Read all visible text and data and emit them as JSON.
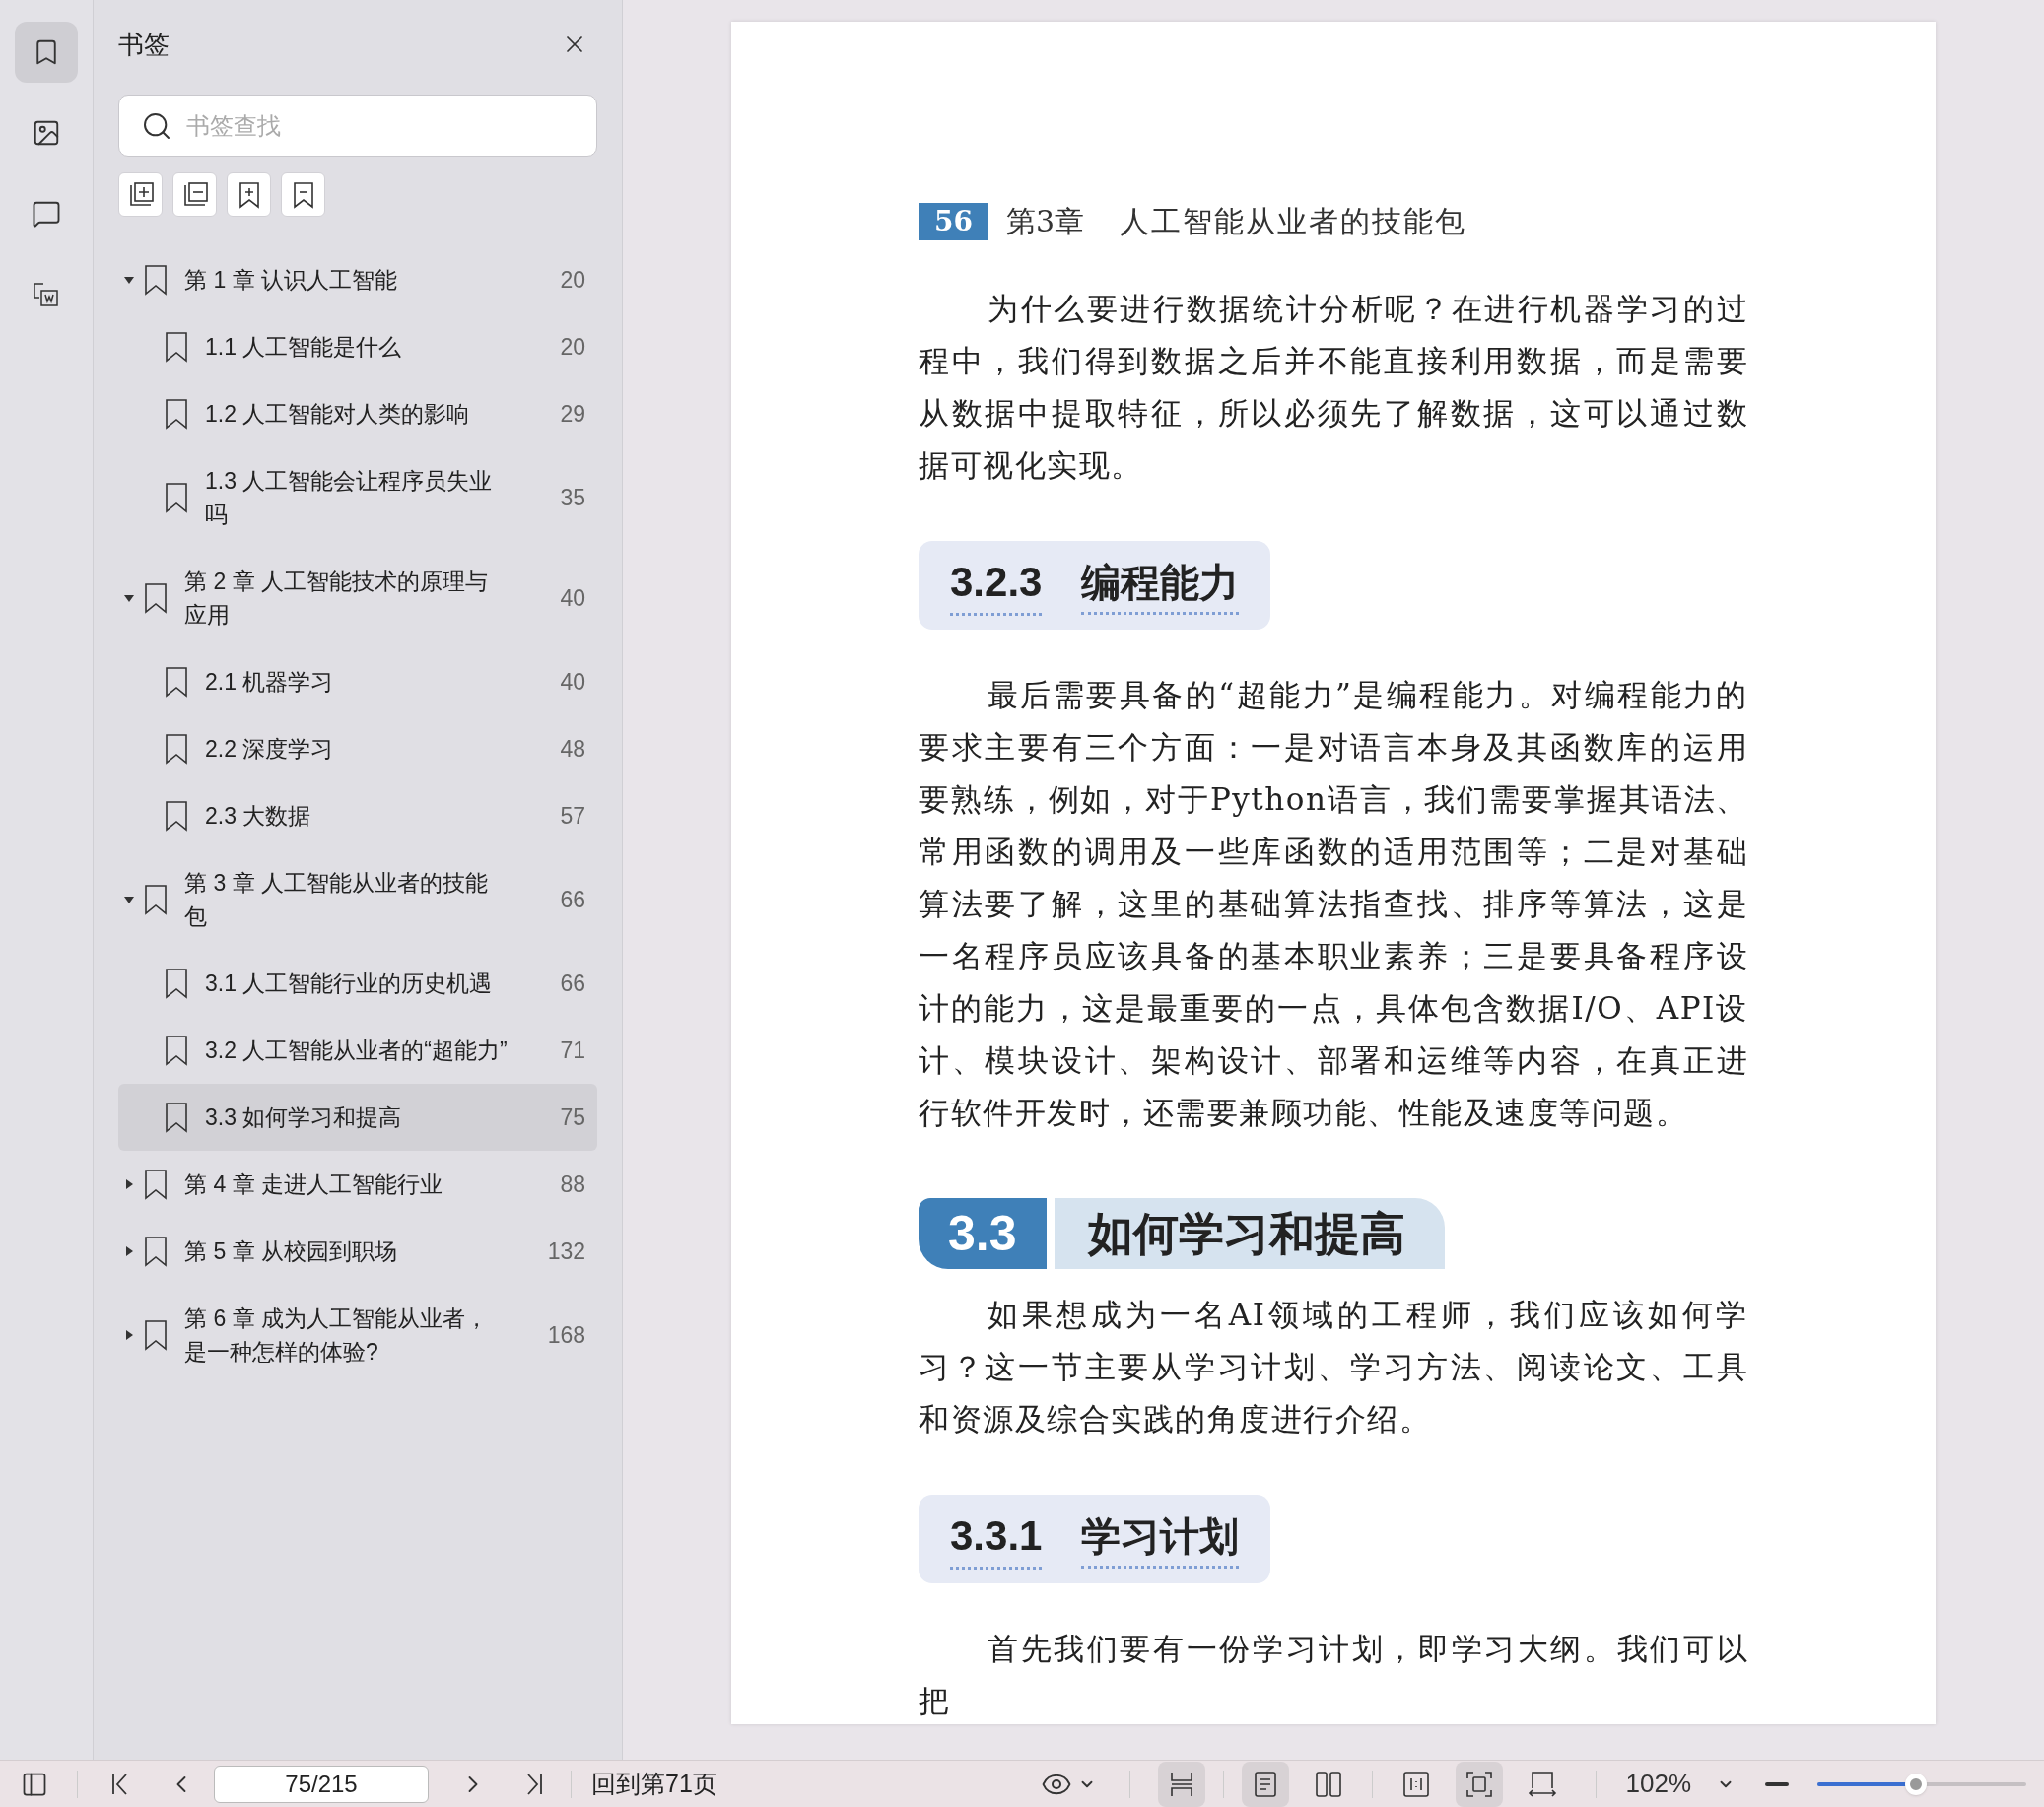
{
  "rail": [
    {
      "kind": "bookmarks",
      "selected": true
    },
    {
      "kind": "images",
      "selected": false
    },
    {
      "kind": "comments",
      "selected": false
    },
    {
      "kind": "convert",
      "selected": false
    }
  ],
  "sidebar": {
    "title": "书签",
    "search": {
      "placeholder": "书签查找"
    },
    "tools": [
      {
        "kind": "expand"
      },
      {
        "kind": "collapse"
      },
      {
        "kind": "add"
      },
      {
        "kind": "remove"
      }
    ],
    "items": [
      {
        "label": "第 1 章 认识人工智能",
        "page": "20",
        "expanded": true,
        "selected": false,
        "children": [
          {
            "label": "1.1 人工智能是什么",
            "page": "20",
            "selected": false
          },
          {
            "label": "1.2 人工智能对人类的影响",
            "page": "29",
            "selected": false
          },
          {
            "label": "1.3 人工智能会让程序员失业吗",
            "page": "35",
            "selected": false
          }
        ]
      },
      {
        "label": "第 2 章 人工智能技术的原理与应用",
        "page": "40",
        "expanded": true,
        "selected": false,
        "children": [
          {
            "label": "2.1 机器学习",
            "page": "40",
            "selected": false
          },
          {
            "label": "2.2 深度学习",
            "page": "48",
            "selected": false
          },
          {
            "label": "2.3 大数据",
            "page": "57",
            "selected": false
          }
        ]
      },
      {
        "label": "第 3 章 人工智能从业者的技能包",
        "page": "66",
        "expanded": true,
        "selected": false,
        "children": [
          {
            "label": "3.1 人工智能行业的历史机遇",
            "page": "66",
            "selected": false
          },
          {
            "label": "3.2 人工智能从业者的“超能力”",
            "page": "71",
            "selected": false
          },
          {
            "label": "3.3 如何学习和提高",
            "page": "75",
            "selected": true
          }
        ]
      },
      {
        "label": "第 4 章 走进人工智能行业",
        "page": "88",
        "expanded": false,
        "selected": false
      },
      {
        "label": "第 5 章 从校园到职场",
        "page": "132",
        "expanded": false,
        "selected": false
      },
      {
        "label": "第 6 章 成为人工智能从业者，是一种怎样的体验?",
        "page": "168",
        "expanded": false,
        "selected": false
      }
    ]
  },
  "page": {
    "number": "56",
    "chapter": "第3章",
    "chapter_title": "人工智能从业者的技能包",
    "blocks": [
      {
        "kind": "paragraph",
        "text": "为什么要进行数据统计分析呢？在进行机器学习的过程中，我们得到数据之后并不能直接利用数据，而是需要从数据中提取特征，所以必须先了解数据，这可以通过数据可视化实现。"
      },
      {
        "kind": "subheading",
        "number": "3.2.3",
        "title": "编程能力"
      },
      {
        "kind": "paragraph",
        "text": "最后需要具备的“超能力”是编程能力。对编程能力的要求主要有三个方面：一是对语言本身及其函数库的运用要熟练，例如，对于Python语言，我们需要掌握其语法、常用函数的调用及一些库函数的适用范围等；二是对基础算法要了解，这里的基础算法指查找、排序等算法，这是一名程序员应该具备的基本职业素养；三是要具备程序设计的能力，这是最重要的一点，具体包含数据I/O、API设计、模块设计、架构设计、部署和运维等内容，在真正进行软件开发时，还需要兼顾功能、性能及速度等问题。"
      },
      {
        "kind": "section",
        "number": "3.3",
        "title": "如何学习和提高"
      },
      {
        "kind": "paragraph",
        "text": "如果想成为一名AI领域的工程师，我们应该如何学习？这一节主要从学习计划、学习方法、阅读论文、工具和资源及综合实践的角度进行介绍。"
      },
      {
        "kind": "subheading",
        "number": "3.3.1",
        "title": "学习计划"
      },
      {
        "kind": "paragraph",
        "text": "首先我们要有一份学习计划，即学习大纲。我们可以把"
      }
    ]
  },
  "toolbar": {
    "page_field": "75/215",
    "back_link": "回到第71页",
    "view_buttons": [
      {
        "kind": "continuous",
        "selected": true
      },
      {
        "kind": "single",
        "selected": true
      },
      {
        "kind": "double",
        "selected": false
      }
    ],
    "fit_buttons": [
      {
        "kind": "actual",
        "selected": false
      },
      {
        "kind": "page",
        "selected": true
      },
      {
        "kind": "width",
        "selected": false
      }
    ],
    "zoom": "102%",
    "zoom_level": {
      "level": 0.47
    }
  }
}
